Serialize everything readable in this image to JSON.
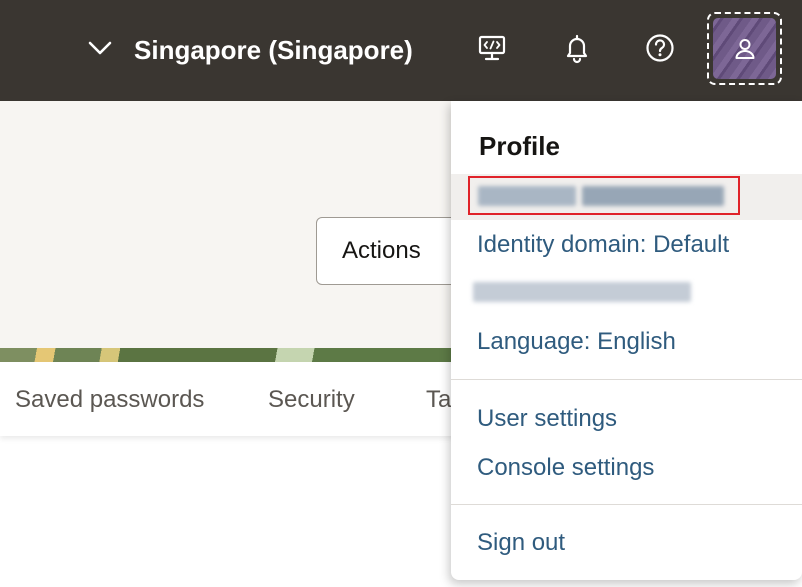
{
  "header": {
    "region_label": "Singapore (Singapore)",
    "icons": [
      "chevron-down-icon",
      "cloud-shell-icon",
      "bell-icon",
      "help-icon",
      "user-icon"
    ],
    "background_color": "#3a3631"
  },
  "page": {
    "actions_label": "Actions",
    "tabs": [
      {
        "label": "Saved passwords"
      },
      {
        "label": "Security"
      },
      {
        "label": "Ta"
      }
    ]
  },
  "profile_menu": {
    "title": "Profile",
    "identity_domain": "Identity domain: Default",
    "language": "Language: English",
    "user_settings": "User settings",
    "console_settings": "Console settings",
    "sign_out": "Sign out",
    "link_color": "#2f5b7e",
    "highlight_color": "#e0232a"
  }
}
